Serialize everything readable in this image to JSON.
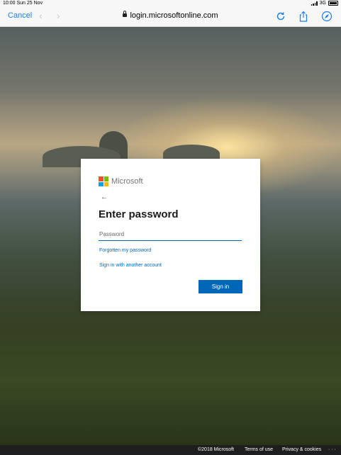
{
  "status_bar": {
    "time": "10:00",
    "date": "Sun 25 Nov",
    "network": "3G"
  },
  "browser": {
    "cancel_label": "Cancel",
    "url": "login.microsoftonline.com"
  },
  "card": {
    "brand_name": "Microsoft",
    "title": "Enter password",
    "password_placeholder": "Password",
    "password_value": "",
    "forgot_link": "Forgotten my password",
    "other_account_link": "Sign in with another account",
    "sign_in_label": "Sign in"
  },
  "footer": {
    "copyright": "©2018 Microsoft",
    "terms": "Terms of use",
    "privacy": "Privacy & cookies",
    "more": "· · ·"
  },
  "colors": {
    "accent": "#0067b8",
    "ios_blue": "#1a7cf3",
    "ms_red": "#f25022",
    "ms_green": "#7fba00",
    "ms_blue": "#00a4ef",
    "ms_yellow": "#ffb900"
  },
  "icons": [
    "back-arrow-icon",
    "forward-arrow-icon",
    "lock-icon",
    "reload-icon",
    "share-icon",
    "compass-icon",
    "microsoft-logo"
  ]
}
